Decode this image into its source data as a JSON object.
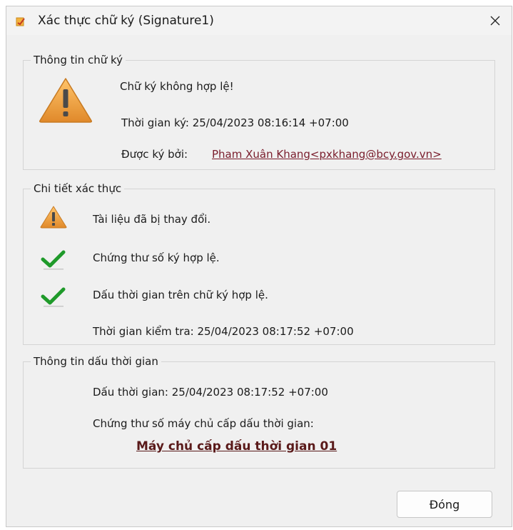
{
  "window": {
    "title": "Xác thực chữ ký (Signature1)",
    "close_symbol": "✕"
  },
  "signature_info": {
    "group_title": "Thông tin chữ ký",
    "status": "Chữ ký không hợp lệ!",
    "signed_time": "Thời gian ký: 25/04/2023 08:16:14 +07:00",
    "signed_by_label": "Được ký bởi:",
    "signer": "Pham Xuân Khang<pxkhang@bcy.gov.vn>",
    "status_icon": "warning-icon"
  },
  "verification_details": {
    "group_title": "Chi tiết xác thực",
    "items": [
      {
        "text": "Tài liệu đã bị thay đổi.",
        "icon": "warning-icon"
      },
      {
        "text": "Chứng thư số ký hợp lệ.",
        "icon": "check-icon"
      },
      {
        "text": "Dấu thời gian trên chữ ký hợp lệ.",
        "icon": "check-icon"
      }
    ],
    "check_time": "Thời gian kiểm tra: 25/04/2023 08:17:52 +07:00"
  },
  "timestamp_info": {
    "group_title": "Thông tin dấu thời gian",
    "timestamp": "Dấu thời gian: 25/04/2023 08:17:52 +07:00",
    "tsa_label": "Chứng thư số máy chủ cấp dấu thời gian:",
    "tsa_server": "Máy chủ cấp dấu thời gian 01"
  },
  "footer": {
    "close_button": "Đóng"
  },
  "colors": {
    "warning": "#f2a33a",
    "check": "#1f9a2a",
    "link": "#7a1d2c"
  }
}
